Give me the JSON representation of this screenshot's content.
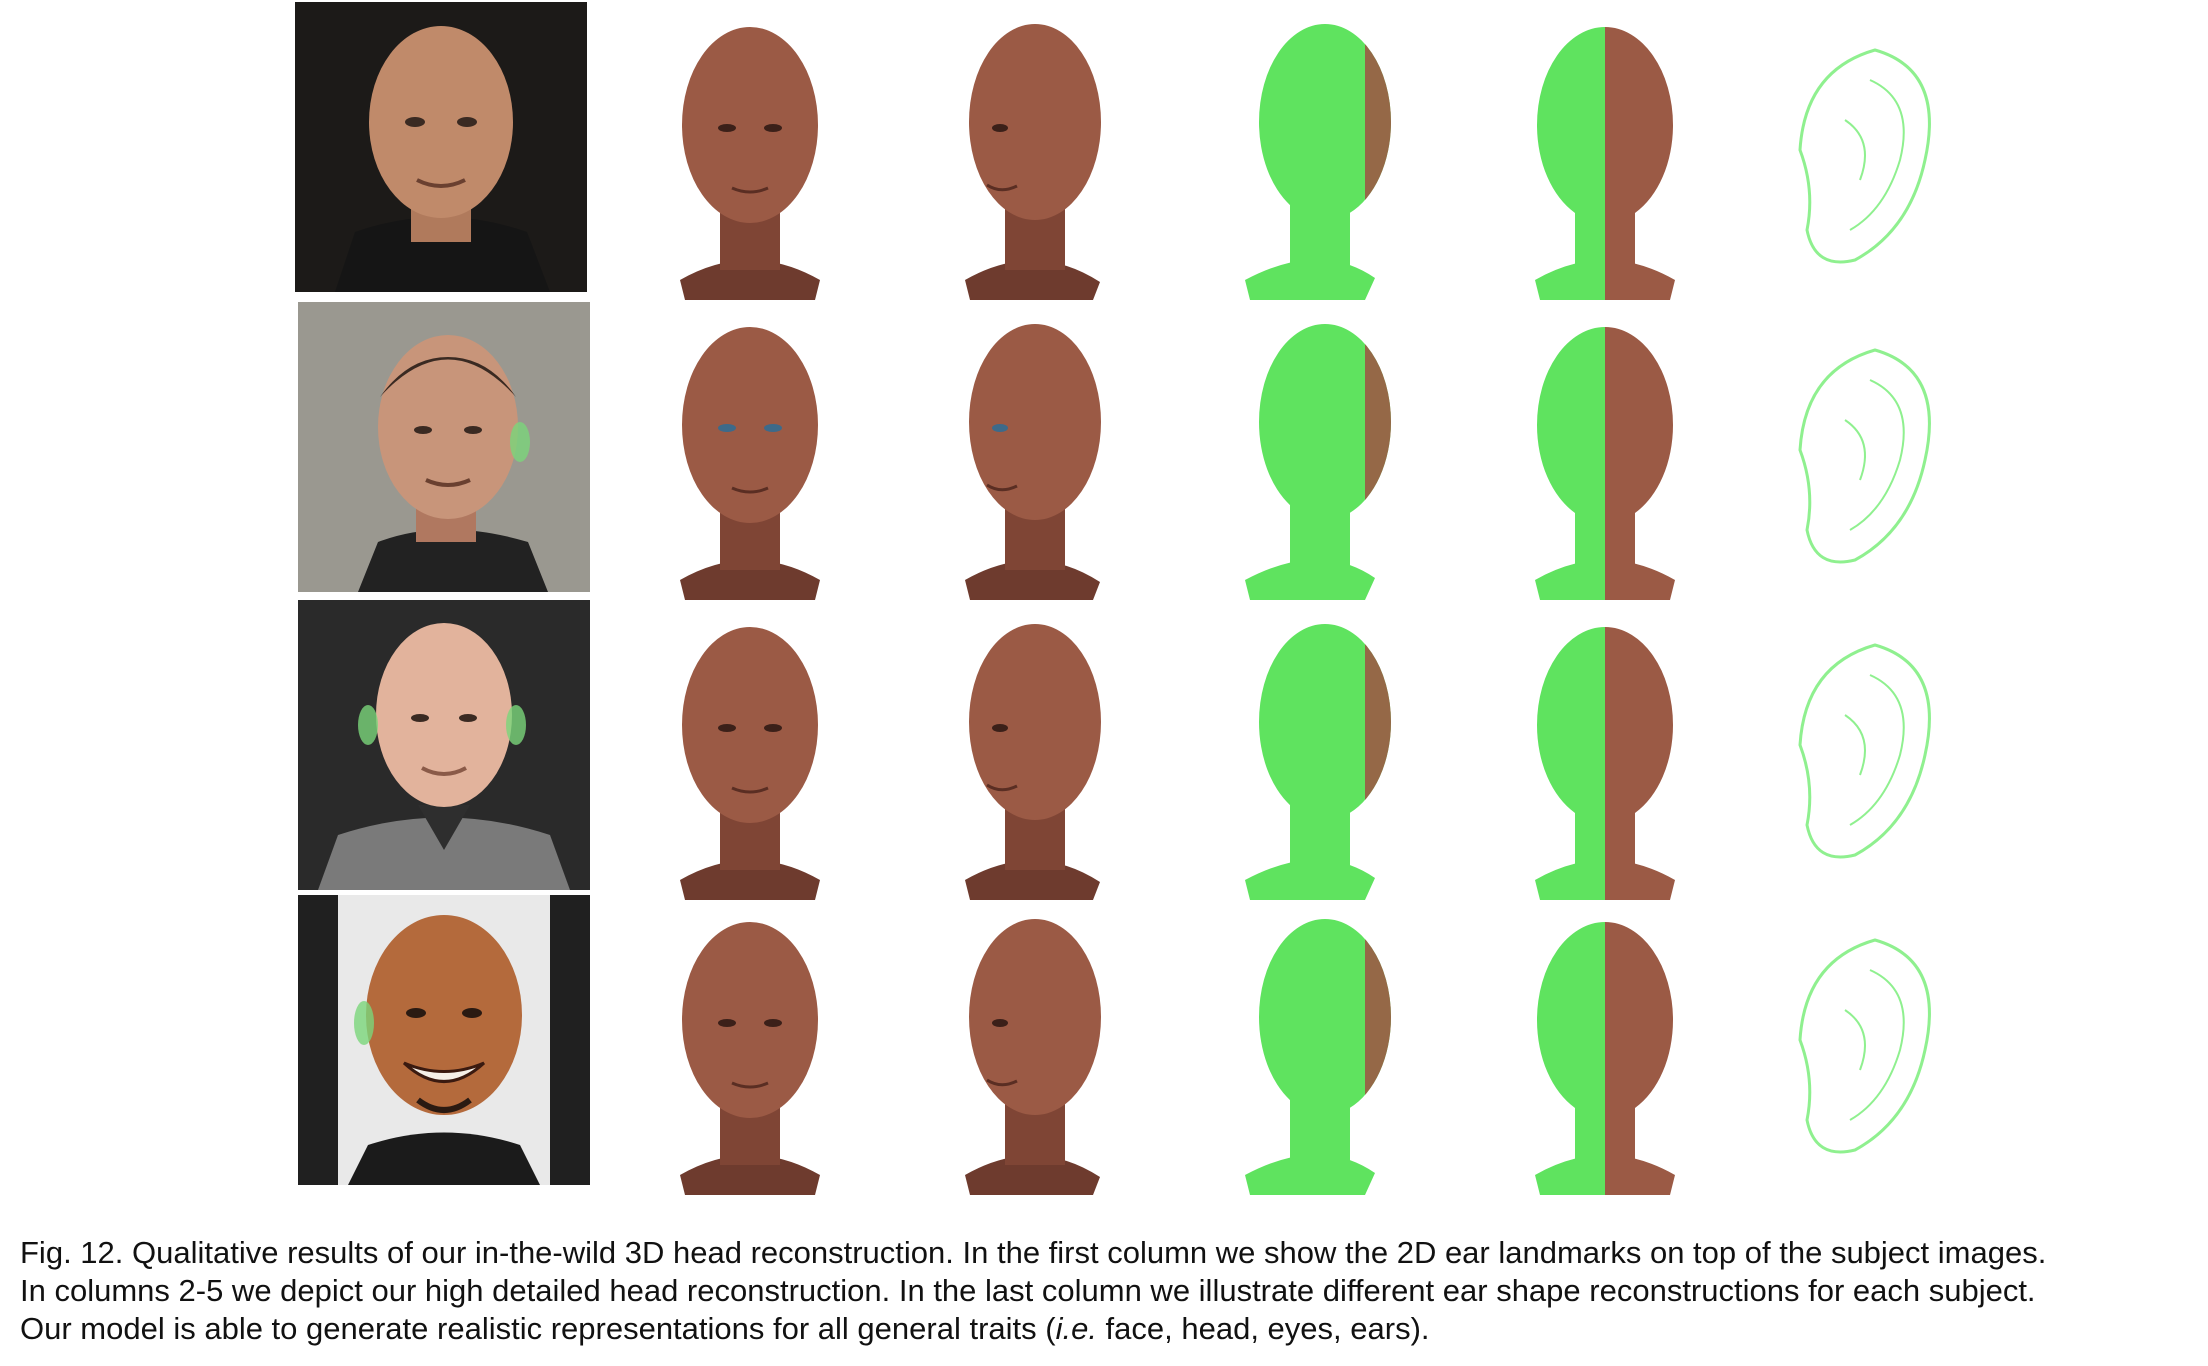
{
  "colors": {
    "skin_render": "#9b5a45",
    "skin_render_dark": "#6e3b2e",
    "overlay_green": "#5fe35f",
    "mesh_green": "#8ff08f"
  },
  "rows": [
    {
      "subject": "subject-1",
      "photo_bg": "#1c1a18",
      "skin": "#c08a6a",
      "shirt": "#151515"
    },
    {
      "subject": "subject-2",
      "photo_bg": "#9a9890",
      "skin": "#c8957a",
      "shirt": "#222222"
    },
    {
      "subject": "subject-3",
      "photo_bg": "#2a2a2a",
      "skin": "#e2b39c",
      "shirt": "#7a7a7a"
    },
    {
      "subject": "subject-4",
      "photo_bg": "#e9e9e9",
      "skin": "#b46a3c",
      "shirt": "#1b1b1b"
    }
  ],
  "caption": {
    "line1": "Fig. 12. Qualitative results of our in-the-wild 3D head reconstruction. In the first column we show the 2D ear landmarks on top of the subject images.",
    "line2": "In columns 2-5 we depict our high detailed head reconstruction. In the last column we illustrate different ear shape reconstructions for each subject.",
    "line3_pre": "Our model is able to generate realistic representations for all general traits (",
    "line3_ie": "i.e.",
    "line3_post": " face, head, eyes, ears)."
  }
}
